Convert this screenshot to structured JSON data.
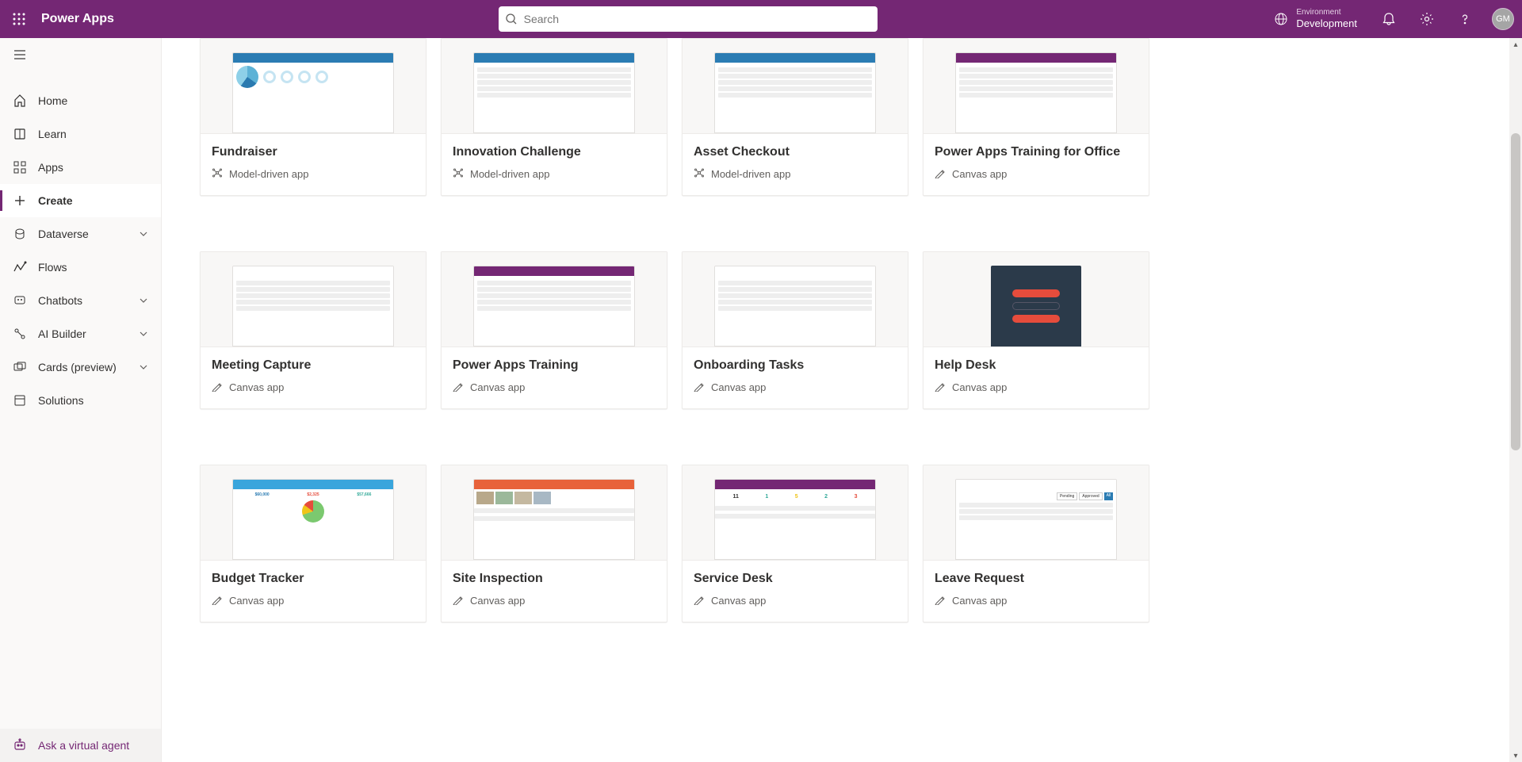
{
  "header": {
    "app_title": "Power Apps",
    "search_placeholder": "Search",
    "env_label": "Environment",
    "env_name": "Development",
    "avatar_initials": "GM"
  },
  "sidebar": {
    "items": [
      {
        "label": "Home",
        "icon": "home",
        "expandable": false
      },
      {
        "label": "Learn",
        "icon": "book",
        "expandable": false
      },
      {
        "label": "Apps",
        "icon": "grid",
        "expandable": false
      },
      {
        "label": "Create",
        "icon": "plus",
        "expandable": false,
        "active": true
      },
      {
        "label": "Dataverse",
        "icon": "dataverse",
        "expandable": true
      },
      {
        "label": "Flows",
        "icon": "flow",
        "expandable": false
      },
      {
        "label": "Chatbots",
        "icon": "chatbot",
        "expandable": true
      },
      {
        "label": "AI Builder",
        "icon": "ai",
        "expandable": true
      },
      {
        "label": "Cards (preview)",
        "icon": "cards",
        "expandable": true
      },
      {
        "label": "Solutions",
        "icon": "solutions",
        "expandable": false
      }
    ],
    "footer_label": "Ask a virtual agent"
  },
  "app_types": {
    "model_driven": "Model-driven app",
    "canvas": "Canvas app"
  },
  "templates": [
    {
      "title": "Fundraiser",
      "type": "model_driven",
      "thumb": "fundraiser"
    },
    {
      "title": "Innovation Challenge",
      "type": "model_driven",
      "thumb": "innovation"
    },
    {
      "title": "Asset Checkout",
      "type": "model_driven",
      "thumb": "asset"
    },
    {
      "title": "Power Apps Training for Office",
      "type": "canvas",
      "thumb": "training-office"
    },
    {
      "title": "Meeting Capture",
      "type": "canvas",
      "thumb": "meeting"
    },
    {
      "title": "Power Apps Training",
      "type": "canvas",
      "thumb": "training"
    },
    {
      "title": "Onboarding Tasks",
      "type": "canvas",
      "thumb": "onboarding"
    },
    {
      "title": "Help Desk",
      "type": "canvas",
      "thumb": "helpdesk"
    },
    {
      "title": "Budget Tracker",
      "type": "canvas",
      "thumb": "budget"
    },
    {
      "title": "Site Inspection",
      "type": "canvas",
      "thumb": "site"
    },
    {
      "title": "Service Desk",
      "type": "canvas",
      "thumb": "service"
    },
    {
      "title": "Leave Request",
      "type": "canvas",
      "thumb": "leave"
    }
  ]
}
